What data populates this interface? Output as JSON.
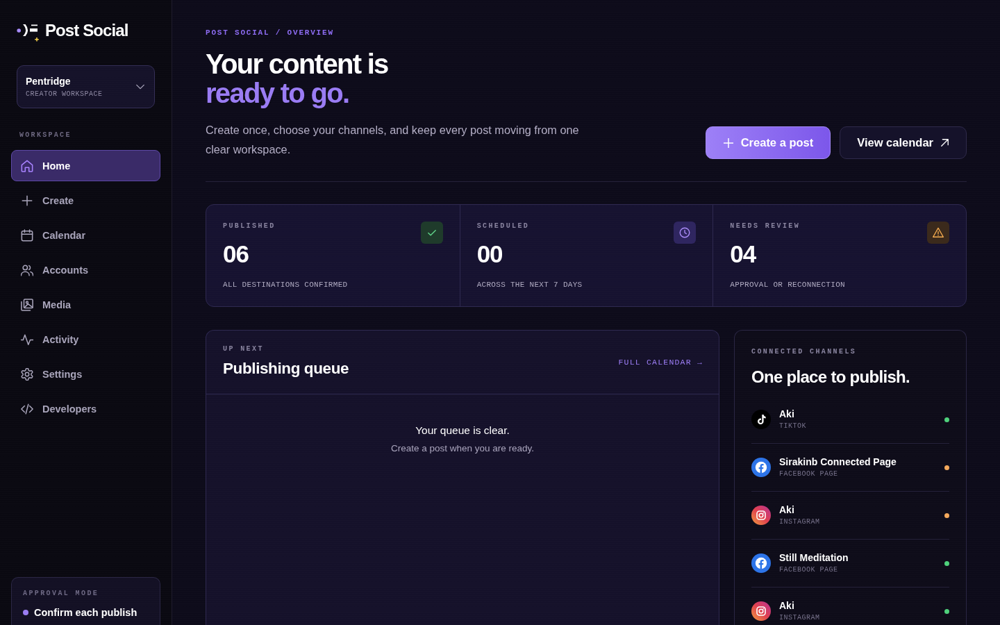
{
  "sidebar": {
    "brand": "Post Social",
    "workspace": {
      "name": "Pentridge",
      "subtitle": "CREATOR WORKSPACE"
    },
    "section_label": "WORKSPACE",
    "nav": [
      {
        "label": "Home",
        "kind": "home",
        "selected": true
      },
      {
        "label": "Create",
        "kind": "plus",
        "selected": false
      },
      {
        "label": "Calendar",
        "kind": "calendar",
        "selected": false
      },
      {
        "label": "Accounts",
        "kind": "people",
        "selected": false
      },
      {
        "label": "Media",
        "kind": "media",
        "selected": false
      },
      {
        "label": "Activity",
        "kind": "pulse",
        "selected": false
      },
      {
        "label": "Settings",
        "kind": "gear",
        "selected": false
      },
      {
        "label": "Developers",
        "kind": "code",
        "selected": false
      }
    ],
    "approval_mode": {
      "label": "APPROVAL MODE",
      "value": "Confirm each publish"
    }
  },
  "header": {
    "breadcrumb": "POST SOCIAL / OVERVIEW",
    "title": "Your content is",
    "title_highlight": "ready to go.",
    "description": "Create once, choose your channels, and keep every post moving from one clear workspace.",
    "buttons": [
      {
        "label": "Create a post",
        "kind": "primary"
      },
      {
        "label": "View calendar",
        "kind": "secondary"
      }
    ]
  },
  "stats": [
    {
      "label": "PUBLISHED",
      "value": "06",
      "caption": "ALL DESTINATIONS CONFIRMED",
      "kind": "success"
    },
    {
      "label": "SCHEDULED",
      "value": "00",
      "caption": "ACROSS THE NEXT 7 DAYS",
      "kind": "scheduled"
    },
    {
      "label": "NEEDS REVIEW",
      "value": "04",
      "caption": "APPROVAL OR RECONNECTION",
      "kind": "warning"
    }
  ],
  "queue": {
    "eyebrow": "UP NEXT",
    "title": "Publishing queue",
    "link": "FULL CALENDAR →",
    "empty_title": "Your queue is clear.",
    "empty_text": "Create a post when you are ready."
  },
  "channels": {
    "eyebrow": "CONNECTED CHANNELS",
    "title": "One place to publish.",
    "items": [
      {
        "name": "Aki",
        "platform": "TIKTOK",
        "kind": "tiktok",
        "color": "#4fd17c"
      },
      {
        "name": "Sirakinb Connected Page",
        "platform": "FACEBOOK PAGE",
        "kind": "facebook",
        "color": "#f4a95c"
      },
      {
        "name": "Aki",
        "platform": "INSTAGRAM",
        "kind": "instagram",
        "color": "#f4a95c"
      },
      {
        "name": "Still Meditation",
        "platform": "FACEBOOK PAGE",
        "kind": "facebook",
        "color": "#4fd17c"
      },
      {
        "name": "Aki",
        "platform": "INSTAGRAM",
        "kind": "instagram",
        "color": "#4fd17c"
      }
    ]
  }
}
